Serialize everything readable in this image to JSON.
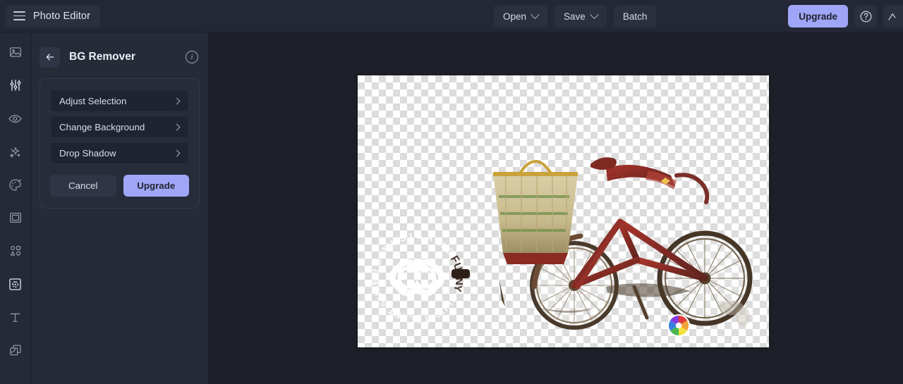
{
  "header": {
    "app_title": "Photo Editor",
    "menu_icon": "hamburger-icon",
    "buttons": [
      {
        "label": "Open",
        "has_caret": true
      },
      {
        "label": "Save",
        "has_caret": true
      },
      {
        "label": "Batch",
        "has_caret": false
      }
    ],
    "upgrade_label": "Upgrade",
    "help_icon": "question-circle-icon",
    "edge_icon": "account-icon"
  },
  "sidebar": {
    "items": [
      {
        "name": "image-icon",
        "label": "Image"
      },
      {
        "name": "adjust-sliders-icon",
        "label": "Adjust"
      },
      {
        "name": "eye-icon",
        "label": "Effects"
      },
      {
        "name": "sparkles-icon",
        "label": "Retouch"
      },
      {
        "name": "palette-icon",
        "label": "Color"
      },
      {
        "name": "frame-icon",
        "label": "Frame"
      },
      {
        "name": "shapes-icon",
        "label": "Shapes"
      },
      {
        "name": "bg-remover-icon",
        "label": "BG Remover"
      },
      {
        "name": "text-icon",
        "label": "Text"
      },
      {
        "name": "layers-icon",
        "label": "Layers"
      }
    ]
  },
  "panel": {
    "back_icon": "arrow-left-icon",
    "title": "BG Remover",
    "info_icon": "info-circle-icon",
    "options": [
      {
        "label": "Adjust Selection"
      },
      {
        "label": "Change Background"
      },
      {
        "label": "Drop Shadow"
      }
    ],
    "cancel_label": "Cancel",
    "upgrade_label": "Upgrade"
  },
  "canvas": {
    "transparency": "checkerboard",
    "subject": "vintage red bicycle with woven basket",
    "watermark": "color-wheel-logo",
    "badge": "circular-white-clover-badge"
  },
  "colors": {
    "accent": "#9fa5f7",
    "header_bg": "#242836",
    "panel_bg": "#262b38",
    "rail_bg": "#252a37",
    "stage_bg": "#1e2029",
    "text_primary": "#eceef4",
    "text_secondary": "#d9dce6"
  }
}
